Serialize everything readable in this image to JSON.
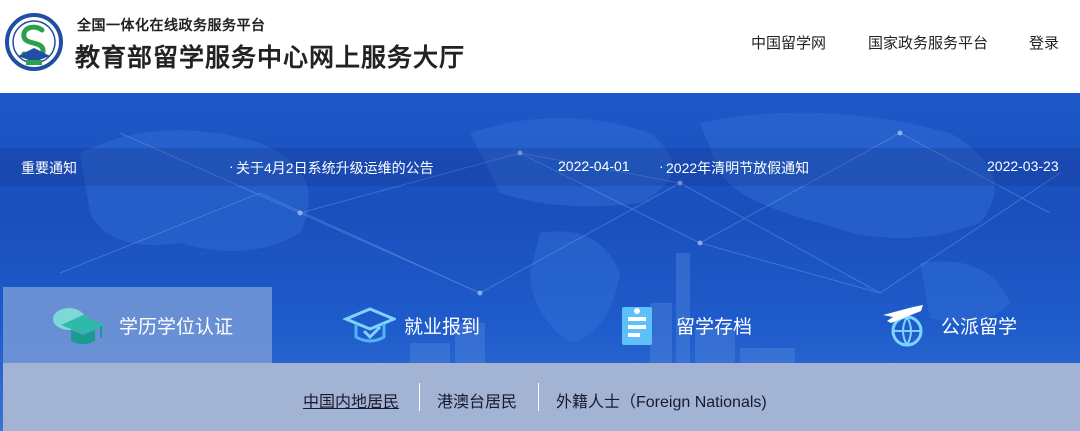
{
  "header": {
    "subtitle": "全国一体化在线政务服务平台",
    "title": "教育部留学服务中心网上服务大厅",
    "nav": [
      "中国留学网",
      "国家政务服务平台",
      "登录"
    ]
  },
  "notice": {
    "label": "重要通知",
    "bullet": "·",
    "items": [
      {
        "text": "关于4月2日系统升级运维的公告",
        "date": "2022-04-01"
      },
      {
        "text": "2022年清明节放假通知",
        "date": "2022-03-23"
      }
    ]
  },
  "services": [
    {
      "label": "学历学位认证",
      "icon": "graduation-cap-icon"
    },
    {
      "label": "就业报到",
      "icon": "employment-cap-icon"
    },
    {
      "label": "留学存档",
      "icon": "archive-folder-icon"
    },
    {
      "label": "公派留学",
      "icon": "airplane-globe-icon"
    }
  ],
  "sub_options": [
    "中国内地居民",
    "港澳台居民",
    "外籍人士（Foreign Nationals)"
  ],
  "colors": {
    "banner": "#1e58c8",
    "active_tab": "#82a0d7",
    "sub_bar": "#a2b3d4",
    "logo_blue": "#1f4ea3",
    "logo_green": "#2ca04a"
  }
}
